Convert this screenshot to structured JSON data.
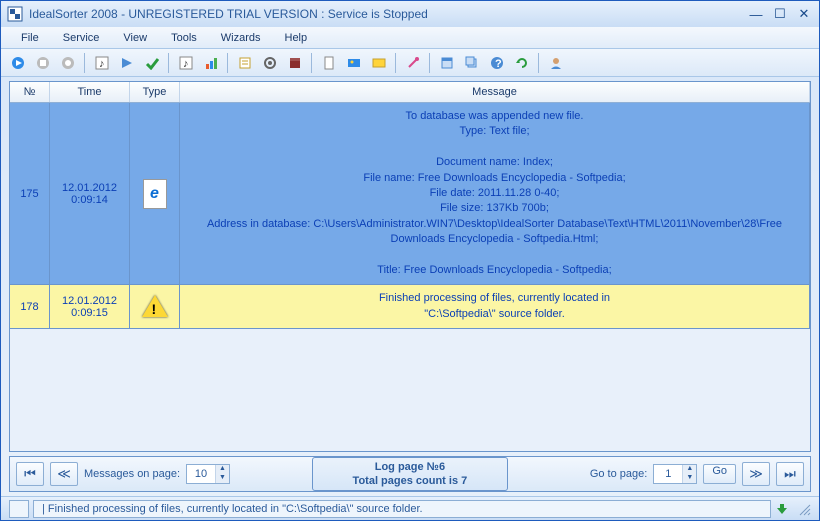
{
  "titlebar": {
    "title": "IdealSorter 2008 - UNREGISTERED TRIAL VERSION : Service is Stopped"
  },
  "menu": {
    "file": "File",
    "service": "Service",
    "view": "View",
    "tools": "Tools",
    "wizards": "Wizards",
    "help": "Help"
  },
  "grid": {
    "headers": {
      "n": "№",
      "time": "Time",
      "type": "Type",
      "message": "Message"
    },
    "rows": [
      {
        "n": "175",
        "time": "12.01.2012\n0:09:14",
        "type": "ie",
        "class": "blue",
        "message": "To database was appended new file.\nType:  Text file;\n\nDocument name:  Index;\nFile name:  Free Downloads Encyclopedia - Softpedia;\nFile date:  2011.11.28 0-40;\nFile size:  137Kb 700b;\nAddress in database:  C:\\Users\\Administrator.WIN7\\Desktop\\IdealSorter Database\\Text\\HTML\\2011\\November\\28\\Free Downloads Encyclopedia - Softpedia.Html;\n\nTitle:  Free Downloads Encyclopedia - Softpedia;"
      },
      {
        "n": "178",
        "time": "12.01.2012\n0:09:15",
        "type": "warn",
        "class": "yellow",
        "message": "Finished processing of files, currently located in\n\"C:\\Softpedia\\\" source folder."
      }
    ]
  },
  "pager": {
    "messages_label": "Messages on page:",
    "messages_value": "10",
    "info_line1": "Log page №6",
    "info_line2": "Total pages count is 7",
    "goto_label": "Go to page:",
    "goto_value": "1",
    "go_label": "Go"
  },
  "status": {
    "text": "| Finished processing of files, currently located in  \"C:\\Softpedia\\\" source folder."
  }
}
